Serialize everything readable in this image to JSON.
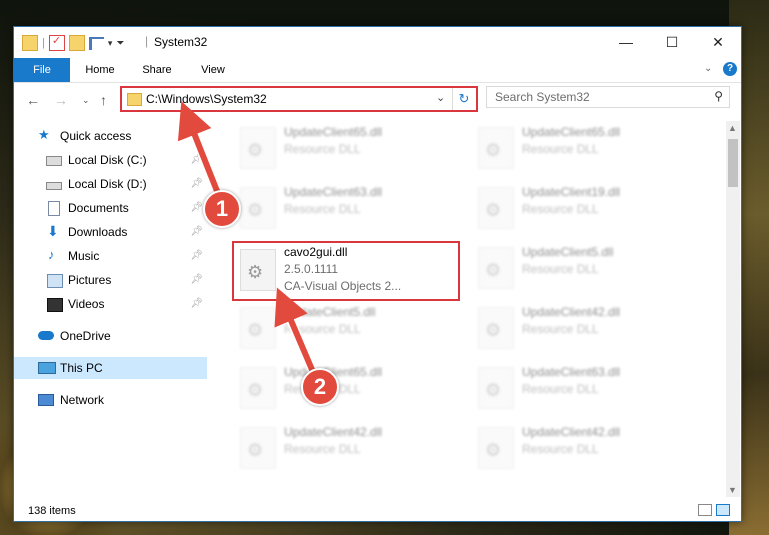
{
  "window": {
    "title": "System32"
  },
  "ribbon": {
    "tabs": [
      "File",
      "Home",
      "Share",
      "View"
    ]
  },
  "address": {
    "path": "C:\\Windows\\System32"
  },
  "search": {
    "placeholder": "Search System32"
  },
  "sidebar": {
    "items": [
      {
        "label": "Quick access",
        "icon": "star-icon"
      },
      {
        "label": "Local Disk (C:)",
        "icon": "drive-icon",
        "pinned": true
      },
      {
        "label": "Local Disk (D:)",
        "icon": "drive-icon",
        "pinned": true
      },
      {
        "label": "Documents",
        "icon": "documents-icon",
        "pinned": true
      },
      {
        "label": "Downloads",
        "icon": "downloads-icon",
        "pinned": true
      },
      {
        "label": "Music",
        "icon": "music-icon",
        "pinned": true
      },
      {
        "label": "Pictures",
        "icon": "pictures-icon",
        "pinned": true
      },
      {
        "label": "Videos",
        "icon": "videos-icon",
        "pinned": true
      },
      {
        "label": "OneDrive",
        "icon": "onedrive-icon"
      },
      {
        "label": "This PC",
        "icon": "pc-icon",
        "selected": true
      },
      {
        "label": "Network",
        "icon": "network-icon"
      }
    ]
  },
  "files": {
    "highlighted": {
      "name": "cavo2gui.dll",
      "version": "2.5.0.1111",
      "description": "CA-Visual Objects 2..."
    },
    "left_column": [
      {
        "name": "UpdateClient65.dll",
        "type": "Resource DLL"
      },
      {
        "name": "UpdateClient63.dll",
        "type": "Resource DLL"
      },
      {
        "name": "UpdateClient5.dll",
        "type": "Resource DLL"
      },
      {
        "name": "UpdateClient65.dll",
        "type": "Resource DLL"
      },
      {
        "name": "UpdateClient42.dll",
        "type": "Resource DLL"
      }
    ],
    "right_column": [
      {
        "name": "UpdateClient65.dll",
        "type": "Resource DLL"
      },
      {
        "name": "UpdateClient19.dll",
        "type": "Resource DLL"
      },
      {
        "name": "UpdateClient5.dll",
        "type": "Resource DLL"
      },
      {
        "name": "UpdateClient42.dll",
        "type": "Resource DLL"
      },
      {
        "name": "UpdateClient63.dll",
        "type": "Resource DLL"
      },
      {
        "name": "UpdateClient42.dll",
        "type": "Resource DLL"
      }
    ]
  },
  "status": {
    "item_count": "138 items"
  },
  "callouts": {
    "one": "1",
    "two": "2"
  },
  "colors": {
    "accent": "#1979ca",
    "highlight": "#d9363e",
    "callout": "#e24a3d"
  }
}
